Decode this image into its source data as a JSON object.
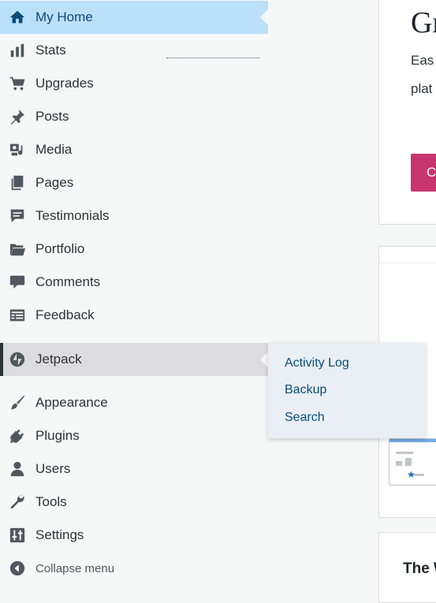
{
  "sidebar": {
    "items": [
      {
        "label": "My Home",
        "icon": "home-icon"
      },
      {
        "label": "Stats",
        "icon": "stats-icon"
      },
      {
        "label": "Upgrades",
        "icon": "cart-icon"
      },
      {
        "label": "Posts",
        "icon": "pin-icon"
      },
      {
        "label": "Media",
        "icon": "media-icon"
      },
      {
        "label": "Pages",
        "icon": "pages-icon"
      },
      {
        "label": "Testimonials",
        "icon": "testimonial-icon"
      },
      {
        "label": "Portfolio",
        "icon": "folder-icon"
      },
      {
        "label": "Comments",
        "icon": "comment-icon"
      },
      {
        "label": "Feedback",
        "icon": "feedback-icon"
      },
      {
        "label": "Jetpack",
        "icon": "jetpack-icon"
      },
      {
        "label": "Appearance",
        "icon": "brush-icon"
      },
      {
        "label": "Plugins",
        "icon": "plug-icon"
      },
      {
        "label": "Users",
        "icon": "user-icon"
      },
      {
        "label": "Tools",
        "icon": "wrench-icon"
      },
      {
        "label": "Settings",
        "icon": "sliders-icon"
      }
    ],
    "collapse_label": "Collapse menu",
    "active_item": "My Home",
    "hovered_item": "Jetpack"
  },
  "flyout": {
    "items": [
      "Activity Log",
      "Backup",
      "Search"
    ]
  },
  "main": {
    "card1": {
      "heading": "Gr",
      "line1": "Eas",
      "line2": "plat",
      "button_label": "Cr"
    },
    "card3": {
      "heading": "The W"
    }
  },
  "colors": {
    "active_bg": "#bbe0fa",
    "active_text": "#0a4b78",
    "hover_bg": "#dcdcde",
    "flyout_bg": "#e9eff5",
    "pink_button": "#c9356e"
  }
}
